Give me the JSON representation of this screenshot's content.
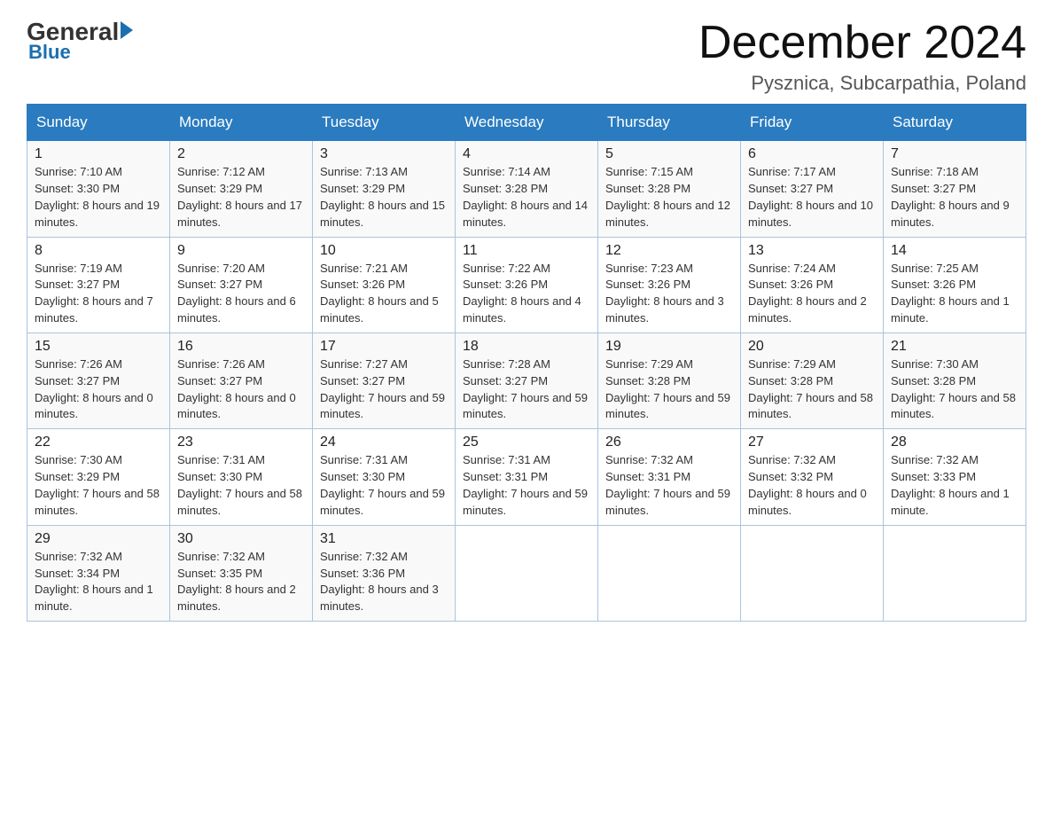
{
  "logo": {
    "general": "General",
    "triangle": "",
    "blue": "Blue"
  },
  "title": "December 2024",
  "location": "Pysznica, Subcarpathia, Poland",
  "headers": [
    "Sunday",
    "Monday",
    "Tuesday",
    "Wednesday",
    "Thursday",
    "Friday",
    "Saturday"
  ],
  "weeks": [
    [
      {
        "day": "1",
        "sunrise": "7:10 AM",
        "sunset": "3:30 PM",
        "daylight": "8 hours and 19 minutes."
      },
      {
        "day": "2",
        "sunrise": "7:12 AM",
        "sunset": "3:29 PM",
        "daylight": "8 hours and 17 minutes."
      },
      {
        "day": "3",
        "sunrise": "7:13 AM",
        "sunset": "3:29 PM",
        "daylight": "8 hours and 15 minutes."
      },
      {
        "day": "4",
        "sunrise": "7:14 AM",
        "sunset": "3:28 PM",
        "daylight": "8 hours and 14 minutes."
      },
      {
        "day": "5",
        "sunrise": "7:15 AM",
        "sunset": "3:28 PM",
        "daylight": "8 hours and 12 minutes."
      },
      {
        "day": "6",
        "sunrise": "7:17 AM",
        "sunset": "3:27 PM",
        "daylight": "8 hours and 10 minutes."
      },
      {
        "day": "7",
        "sunrise": "7:18 AM",
        "sunset": "3:27 PM",
        "daylight": "8 hours and 9 minutes."
      }
    ],
    [
      {
        "day": "8",
        "sunrise": "7:19 AM",
        "sunset": "3:27 PM",
        "daylight": "8 hours and 7 minutes."
      },
      {
        "day": "9",
        "sunrise": "7:20 AM",
        "sunset": "3:27 PM",
        "daylight": "8 hours and 6 minutes."
      },
      {
        "day": "10",
        "sunrise": "7:21 AM",
        "sunset": "3:26 PM",
        "daylight": "8 hours and 5 minutes."
      },
      {
        "day": "11",
        "sunrise": "7:22 AM",
        "sunset": "3:26 PM",
        "daylight": "8 hours and 4 minutes."
      },
      {
        "day": "12",
        "sunrise": "7:23 AM",
        "sunset": "3:26 PM",
        "daylight": "8 hours and 3 minutes."
      },
      {
        "day": "13",
        "sunrise": "7:24 AM",
        "sunset": "3:26 PM",
        "daylight": "8 hours and 2 minutes."
      },
      {
        "day": "14",
        "sunrise": "7:25 AM",
        "sunset": "3:26 PM",
        "daylight": "8 hours and 1 minute."
      }
    ],
    [
      {
        "day": "15",
        "sunrise": "7:26 AM",
        "sunset": "3:27 PM",
        "daylight": "8 hours and 0 minutes."
      },
      {
        "day": "16",
        "sunrise": "7:26 AM",
        "sunset": "3:27 PM",
        "daylight": "8 hours and 0 minutes."
      },
      {
        "day": "17",
        "sunrise": "7:27 AM",
        "sunset": "3:27 PM",
        "daylight": "7 hours and 59 minutes."
      },
      {
        "day": "18",
        "sunrise": "7:28 AM",
        "sunset": "3:27 PM",
        "daylight": "7 hours and 59 minutes."
      },
      {
        "day": "19",
        "sunrise": "7:29 AM",
        "sunset": "3:28 PM",
        "daylight": "7 hours and 59 minutes."
      },
      {
        "day": "20",
        "sunrise": "7:29 AM",
        "sunset": "3:28 PM",
        "daylight": "7 hours and 58 minutes."
      },
      {
        "day": "21",
        "sunrise": "7:30 AM",
        "sunset": "3:28 PM",
        "daylight": "7 hours and 58 minutes."
      }
    ],
    [
      {
        "day": "22",
        "sunrise": "7:30 AM",
        "sunset": "3:29 PM",
        "daylight": "7 hours and 58 minutes."
      },
      {
        "day": "23",
        "sunrise": "7:31 AM",
        "sunset": "3:30 PM",
        "daylight": "7 hours and 58 minutes."
      },
      {
        "day": "24",
        "sunrise": "7:31 AM",
        "sunset": "3:30 PM",
        "daylight": "7 hours and 59 minutes."
      },
      {
        "day": "25",
        "sunrise": "7:31 AM",
        "sunset": "3:31 PM",
        "daylight": "7 hours and 59 minutes."
      },
      {
        "day": "26",
        "sunrise": "7:32 AM",
        "sunset": "3:31 PM",
        "daylight": "7 hours and 59 minutes."
      },
      {
        "day": "27",
        "sunrise": "7:32 AM",
        "sunset": "3:32 PM",
        "daylight": "8 hours and 0 minutes."
      },
      {
        "day": "28",
        "sunrise": "7:32 AM",
        "sunset": "3:33 PM",
        "daylight": "8 hours and 1 minute."
      }
    ],
    [
      {
        "day": "29",
        "sunrise": "7:32 AM",
        "sunset": "3:34 PM",
        "daylight": "8 hours and 1 minute."
      },
      {
        "day": "30",
        "sunrise": "7:32 AM",
        "sunset": "3:35 PM",
        "daylight": "8 hours and 2 minutes."
      },
      {
        "day": "31",
        "sunrise": "7:32 AM",
        "sunset": "3:36 PM",
        "daylight": "8 hours and 3 minutes."
      },
      null,
      null,
      null,
      null
    ]
  ],
  "labels": {
    "sunrise_prefix": "Sunrise: ",
    "sunset_prefix": "Sunset: ",
    "daylight_prefix": "Daylight: "
  }
}
